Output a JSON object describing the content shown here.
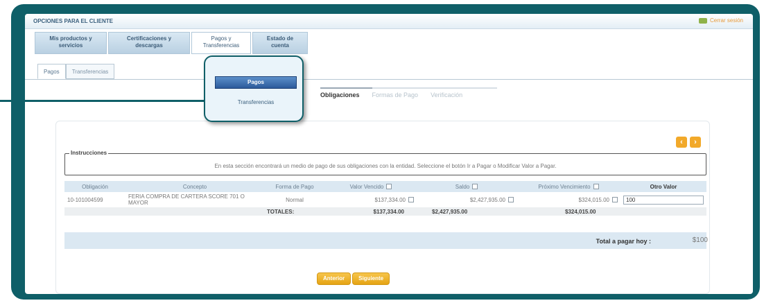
{
  "header": {
    "section_title": "OPCIONES PARA EL CLIENTE",
    "logout_label": "Cerrar sesión"
  },
  "menu": [
    {
      "label": "Mis productos y servicios"
    },
    {
      "label": "Certificaciones y descargas"
    },
    {
      "label": "Pagos y Transferencias"
    },
    {
      "label": "Estado de cuenta"
    }
  ],
  "subtabs": [
    {
      "label": "Pagos"
    },
    {
      "label": "Transferencias"
    }
  ],
  "popup": {
    "active_item": "Pagos",
    "item": "Transferencias"
  },
  "steps": [
    {
      "label": "Obligaciones"
    },
    {
      "label": "Formas de Pago"
    },
    {
      "label": "Verificación"
    }
  ],
  "instructions": {
    "legend": "Instrucciones",
    "text": "En esta sección encontrará un medio de pago de sus obligaciones con la entidad. Seleccione el botón Ir a Pagar o Modificar Valor a Pagar."
  },
  "table": {
    "headers": {
      "obligacion": "Obligación",
      "concepto": "Concepto",
      "forma_pago": "Forma de Pago",
      "valor_vencido": "Valor Vencido",
      "saldo": "Saldo",
      "proximo_vencimiento": "Próximo Vencimiento",
      "otro_valor": "Otro Valor"
    },
    "row": {
      "obligacion": "10-101004599",
      "concepto": "FERIA COMPRA DE CARTERA SCORE 701 O MAYOR",
      "forma_pago": "Normal",
      "valor_vencido": "$137,334.00",
      "saldo": "$2,427,935.00",
      "proximo_vencimiento": "$324,015.00",
      "otro_valor": "100"
    },
    "totals": {
      "label": "TOTALES:",
      "valor_vencido": "$137,334.00",
      "saldo": "$2,427,935.00",
      "proximo_vencimiento": "$324,015.00"
    }
  },
  "total_pagar": {
    "label": "Total a pagar hoy :",
    "value": "$100"
  },
  "buttons": {
    "anterior": "Anterior",
    "siguiente": "Siguiente"
  }
}
